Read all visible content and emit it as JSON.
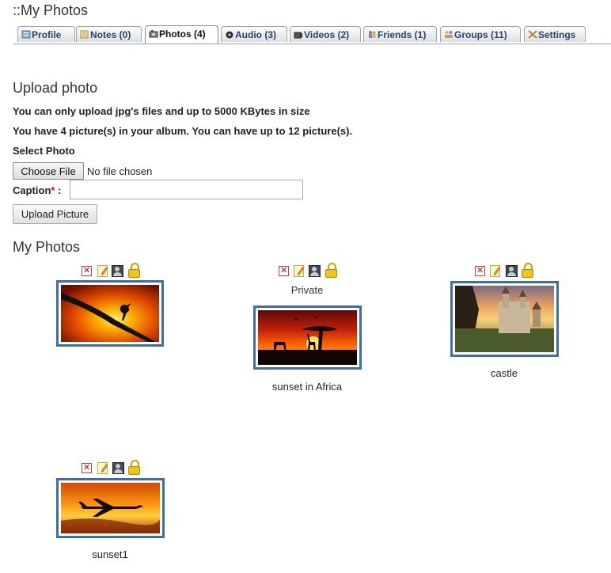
{
  "page": {
    "title": "::My Photos"
  },
  "tabs": [
    {
      "label": "Profile",
      "icon": "profile-icon"
    },
    {
      "label": "Notes (0)",
      "icon": "notes-icon"
    },
    {
      "label": "Photos (4)",
      "icon": "camera-icon",
      "active": true
    },
    {
      "label": "Audio (3)",
      "icon": "audio-icon"
    },
    {
      "label": "Videos (2)",
      "icon": "video-icon"
    },
    {
      "label": "Friends (1)",
      "icon": "friends-icon"
    },
    {
      "label": "Groups (11)",
      "icon": "groups-icon"
    },
    {
      "label": "Settings",
      "icon": "settings-icon"
    }
  ],
  "upload": {
    "heading": "Upload photo",
    "note1": "You can only upload jpg's files and up to 5000 KBytes in size",
    "note2": "You have 4 picture(s) in your album. You can have up to 12 picture(s).",
    "select_label": "Select Photo",
    "choose_button": "Choose File",
    "file_status": "No file chosen",
    "caption_label": "Caption",
    "required_mark": "*",
    "caption_colon": " :",
    "caption_value": "",
    "submit_label": "Upload Picture"
  },
  "gallery": {
    "heading": "My Photos",
    "photos": [
      {
        "caption": "",
        "private_label": "",
        "scene": "bird"
      },
      {
        "caption": "sunset in Africa",
        "private_label": "Private",
        "scene": "africa"
      },
      {
        "caption": "castle",
        "private_label": "",
        "scene": "castle"
      },
      {
        "caption": "sunset1",
        "private_label": "",
        "scene": "plane"
      }
    ]
  },
  "colors": {
    "frame": "#3c6eaa",
    "tab_text": "#2a3f6a",
    "required": "#d11111"
  }
}
